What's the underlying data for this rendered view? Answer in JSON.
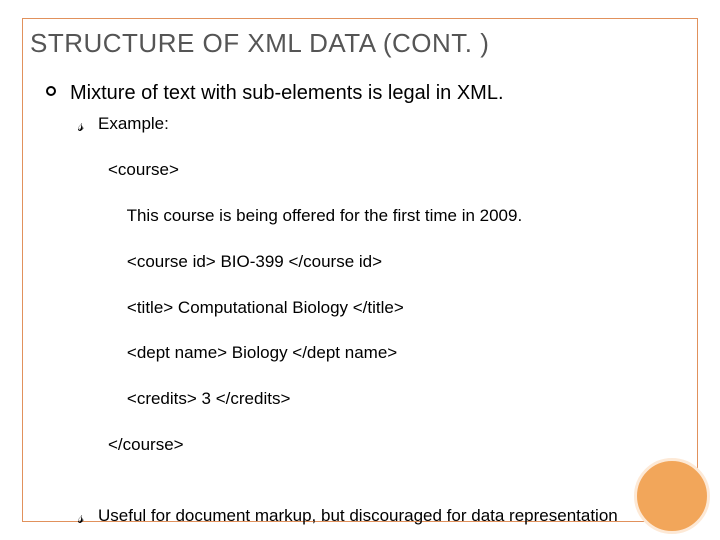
{
  "title": "STRUCTURE OF XML DATA (CONT. )",
  "point1": "Mixture of text with sub-elements is legal in XML.",
  "sub1": "Example:",
  "code": {
    "l1": "<course>",
    "l2": "    This course is being offered for the first time in 2009.",
    "l3": "    <course id> BIO-399 </course id>",
    "l4": "    <title> Computational Biology </title>",
    "l5": "    <dept name> Biology </dept name>",
    "l6": "    <credits> 3 </credits>",
    "l7": "</course>"
  },
  "sub2": "Useful for document markup, but discouraged for data representation"
}
